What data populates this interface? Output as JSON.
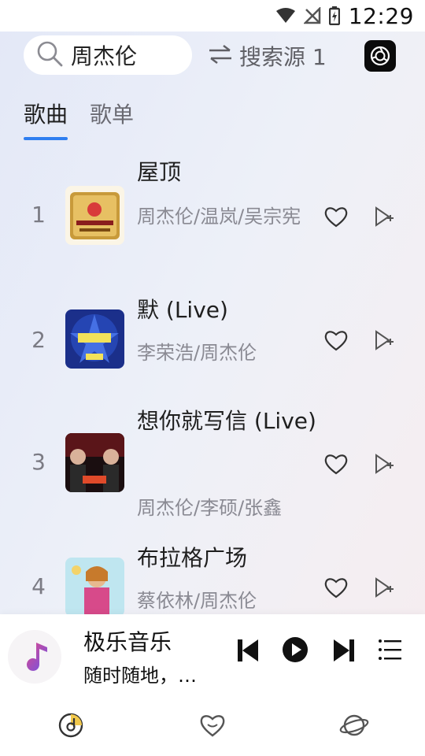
{
  "status_bar": {
    "time": "12:29",
    "icons": [
      "wifi-icon",
      "no-signal-icon",
      "battery-charging-icon"
    ]
  },
  "header": {
    "search_query": "周杰伦",
    "source_label": "搜索源 1",
    "icons": {
      "search": "search-icon",
      "switch": "swap-arrows-icon",
      "logo": "app-logo-icon"
    }
  },
  "tabs": [
    {
      "label": "歌曲",
      "active": true
    },
    {
      "label": "歌单",
      "active": false
    }
  ],
  "songs": [
    {
      "index": "1",
      "title": "屋顶",
      "artist": "周杰伦/温岚/吴宗宪"
    },
    {
      "index": "2",
      "title": "默 (Live)",
      "artist": "李荣浩/周杰伦"
    },
    {
      "index": "3",
      "title": "想你就写信 (Live)",
      "artist": "周杰伦/李硕/张鑫"
    },
    {
      "index": "4",
      "title": "布拉格广场",
      "artist": "蔡依林/周杰伦"
    }
  ],
  "now_playing": {
    "title": "极乐音乐",
    "subtitle": "随时随地，…",
    "controls": [
      "previous-icon",
      "play-icon",
      "next-icon",
      "playlist-icon"
    ]
  },
  "bottom_nav": {
    "items": [
      "music-disc-icon",
      "heart-icon",
      "planet-icon"
    ],
    "active_color": "#f2c94c"
  },
  "colors": {
    "accent": "#2f7ef0",
    "muted_text": "#8a8a93"
  }
}
